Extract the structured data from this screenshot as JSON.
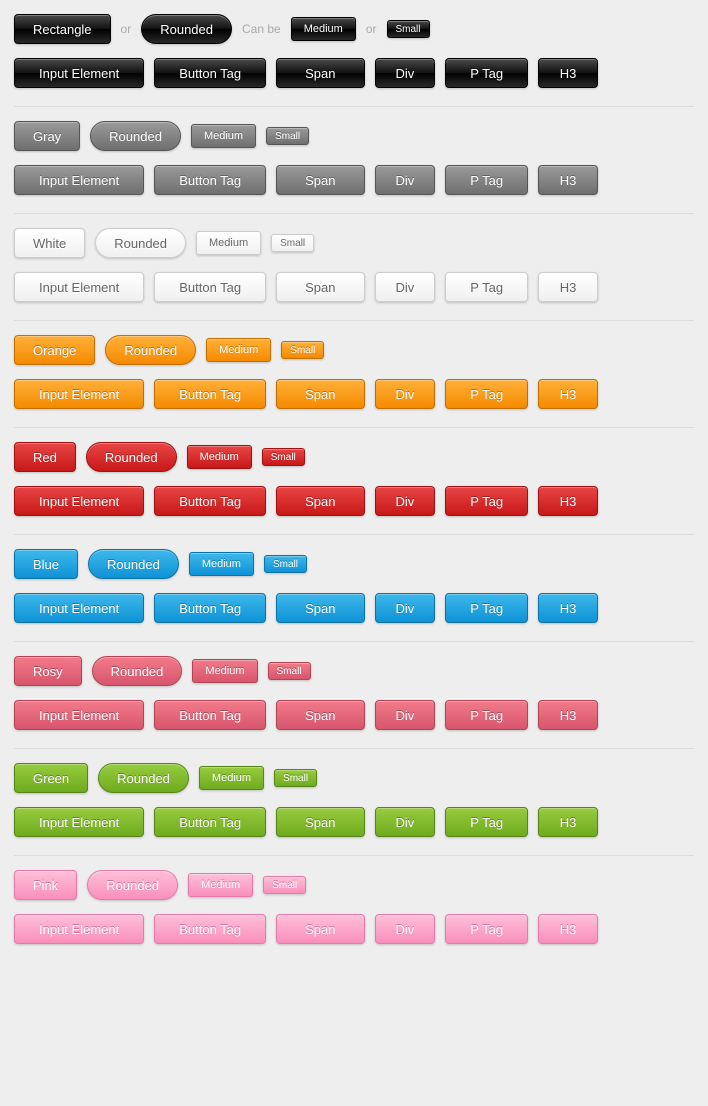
{
  "captions": {
    "or1": "or",
    "canbe": "Can be",
    "or2": "or"
  },
  "labels": {
    "rectangle": "Rectangle",
    "rounded": "Rounded",
    "medium": "Medium",
    "small": "Small",
    "inputElement": "Input Element",
    "buttonTag": "Button Tag",
    "span": "Span",
    "div": "Div",
    "pTag": "P Tag",
    "h3": "H3"
  },
  "rows": [
    {
      "name": "black",
      "firstLabel": "rectangle",
      "showCaptions": true
    },
    {
      "name": "gray",
      "firstLabel": "Gray",
      "showCaptions": false
    },
    {
      "name": "white",
      "firstLabel": "White",
      "showCaptions": false
    },
    {
      "name": "orange",
      "firstLabel": "Orange",
      "showCaptions": false
    },
    {
      "name": "red",
      "firstLabel": "Red",
      "showCaptions": false
    },
    {
      "name": "blue",
      "firstLabel": "Blue",
      "showCaptions": false
    },
    {
      "name": "rosy",
      "firstLabel": "Rosy",
      "showCaptions": false
    },
    {
      "name": "green",
      "firstLabel": "Green",
      "showCaptions": false
    },
    {
      "name": "pink",
      "firstLabel": "Pink",
      "showCaptions": false
    }
  ],
  "colors": {
    "black": "#2a2a2a",
    "gray": "#7a7a7a",
    "white": "#f5f5f5",
    "orange": "#f58a00",
    "red": "#c81818",
    "blue": "#0f93d6",
    "rosy": "#d7566d",
    "green": "#6fab1f",
    "pink": "#f98fbc"
  }
}
